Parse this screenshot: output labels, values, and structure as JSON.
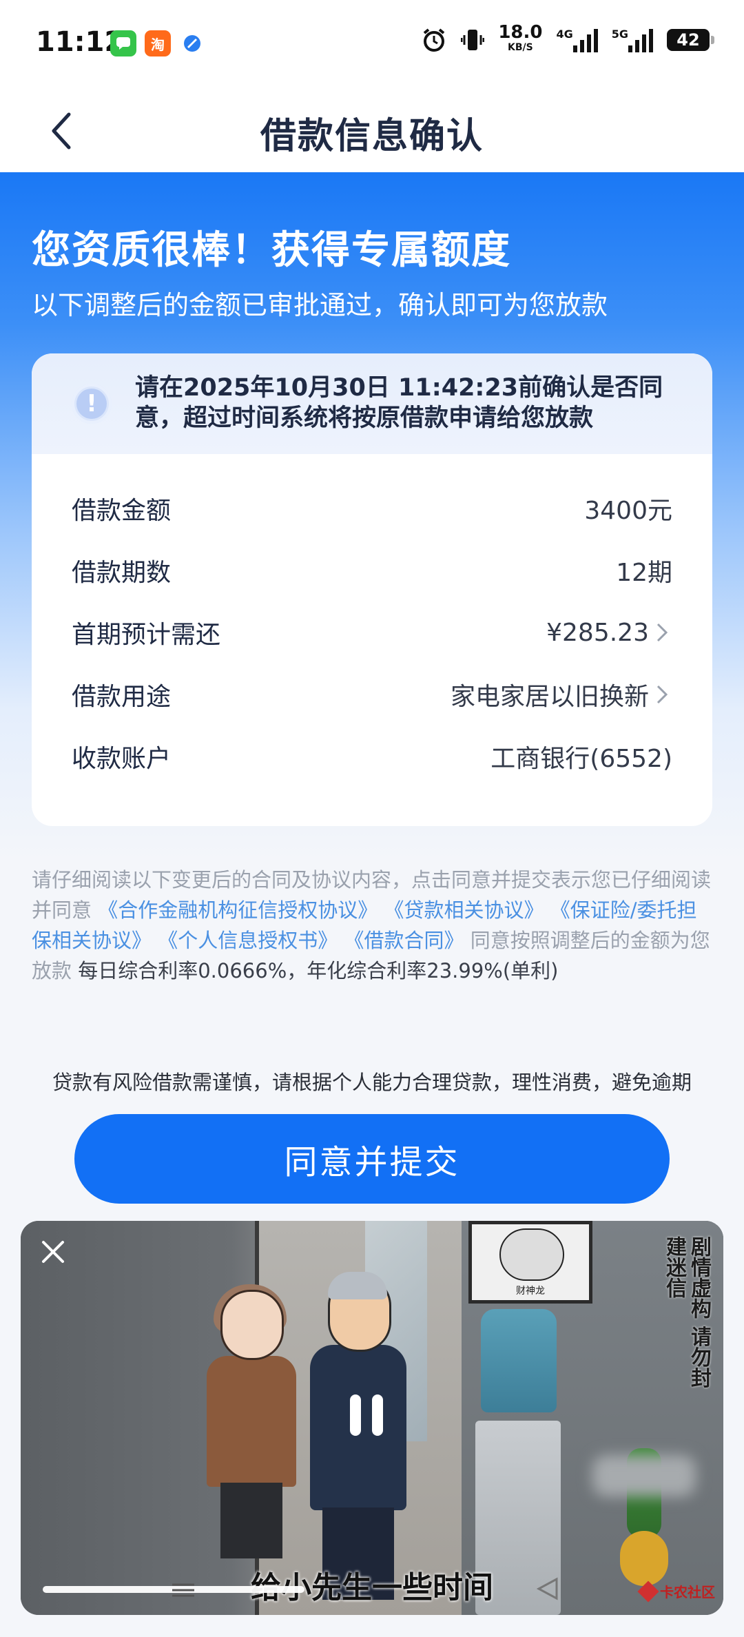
{
  "status_bar": {
    "time": "11:12",
    "notif_icons": [
      "message-icon",
      "taobao-icon",
      "app-icon"
    ],
    "taobao_label": "淘",
    "net_speed_value": "18.0",
    "net_speed_unit": "KB/S",
    "network_4g": "4G",
    "network_5g": "5G",
    "battery": "42"
  },
  "nav": {
    "title": "借款信息确认"
  },
  "hero": {
    "title": "您资质很棒！获得专属额度",
    "subtitle": "以下调整后的金额已审批通过，确认即可为您放款"
  },
  "notice": {
    "text": "请在2025年10月30日 11:42:23前确认是否同意，超过时间系统将按原借款申请给您放款"
  },
  "details": [
    {
      "label": "借款金额",
      "value": "3400元",
      "has_arrow": false
    },
    {
      "label": "借款期数",
      "value": "12期",
      "has_arrow": false
    },
    {
      "label": "首期预计需还",
      "value": "¥285.23",
      "has_arrow": true
    },
    {
      "label": "借款用途",
      "value": "家电家居以旧换新",
      "has_arrow": true
    },
    {
      "label": "收款账户",
      "value": "工商银行(6552)",
      "has_arrow": false
    }
  ],
  "agreement": {
    "intro": "请仔细阅读以下变更后的合同及协议内容，点击同意并提交表示您已仔细阅读并同意",
    "links": [
      "《合作金融机构征信授权协议》",
      "《贷款相关协议》",
      "《保证险/委托担保相关协议》",
      "《个人信息授权书》",
      "《借款合同》"
    ],
    "outro": "同意按照调整后的金额为您放款",
    "rate": "每日综合利率0.0666%，年化综合利率23.99%(单利)"
  },
  "risk_notice": "贷款有风险借款需谨慎，请根据个人能力合理贷款，理性消费，避免逾期",
  "submit_label": "同意并提交",
  "video": {
    "side_text": "剧情虚构 请勿封建迷信",
    "portrait_caption": "财神龙",
    "subtitle": "给小先生一些时间",
    "watermark": "卡农社区"
  },
  "colors": {
    "primary": "#1270f5",
    "link": "#4a90e2",
    "hero_top": "#1a78f5"
  }
}
